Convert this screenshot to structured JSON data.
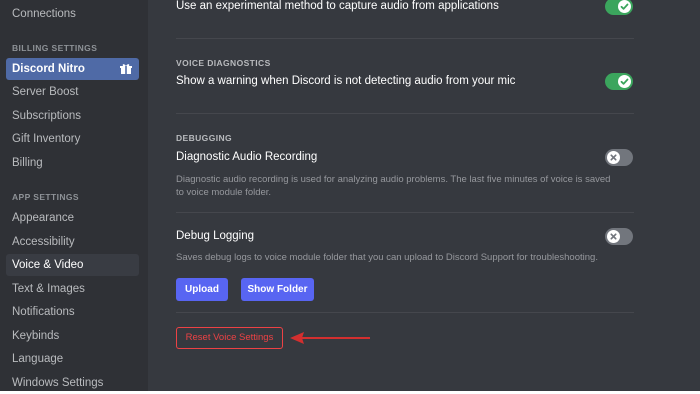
{
  "sidebar": {
    "connections": "Connections",
    "billing_header": "BILLING SETTINGS",
    "billing_items": [
      "Discord Nitro",
      "Server Boost",
      "Subscriptions",
      "Gift Inventory",
      "Billing"
    ],
    "app_header": "APP SETTINGS",
    "app_items": [
      "Appearance",
      "Accessibility",
      "Voice & Video",
      "Text & Images",
      "Notifications",
      "Keybinds",
      "Language",
      "Windows Settings"
    ],
    "selected_item": "Voice & Video"
  },
  "main": {
    "experimental_capture": {
      "label": "Use an experimental method to capture audio from applications",
      "enabled": true
    },
    "voice_diagnostics": {
      "header": "VOICE DIAGNOSTICS",
      "label": "Show a warning when Discord is not detecting audio from your mic",
      "enabled": true
    },
    "debugging": {
      "header": "DEBUGGING",
      "diagnostic_audio": {
        "title": "Diagnostic Audio Recording",
        "description": "Diagnostic audio recording is used for analyzing audio problems. The last five minutes of voice is saved to voice module folder.",
        "enabled": false
      },
      "debug_logging": {
        "title": "Debug Logging",
        "description": "Saves debug logs to voice module folder that you can upload to Discord Support for troubleshooting.",
        "enabled": false
      },
      "upload_label": "Upload",
      "show_folder_label": "Show Folder"
    },
    "reset_label": "Reset Voice Settings"
  },
  "colors": {
    "toggle_on": "#3ba55d",
    "toggle_off": "#72767d",
    "brand_button": "#5865f2",
    "danger": "#ed4245",
    "annotation_arrow": "#d32f2f"
  }
}
